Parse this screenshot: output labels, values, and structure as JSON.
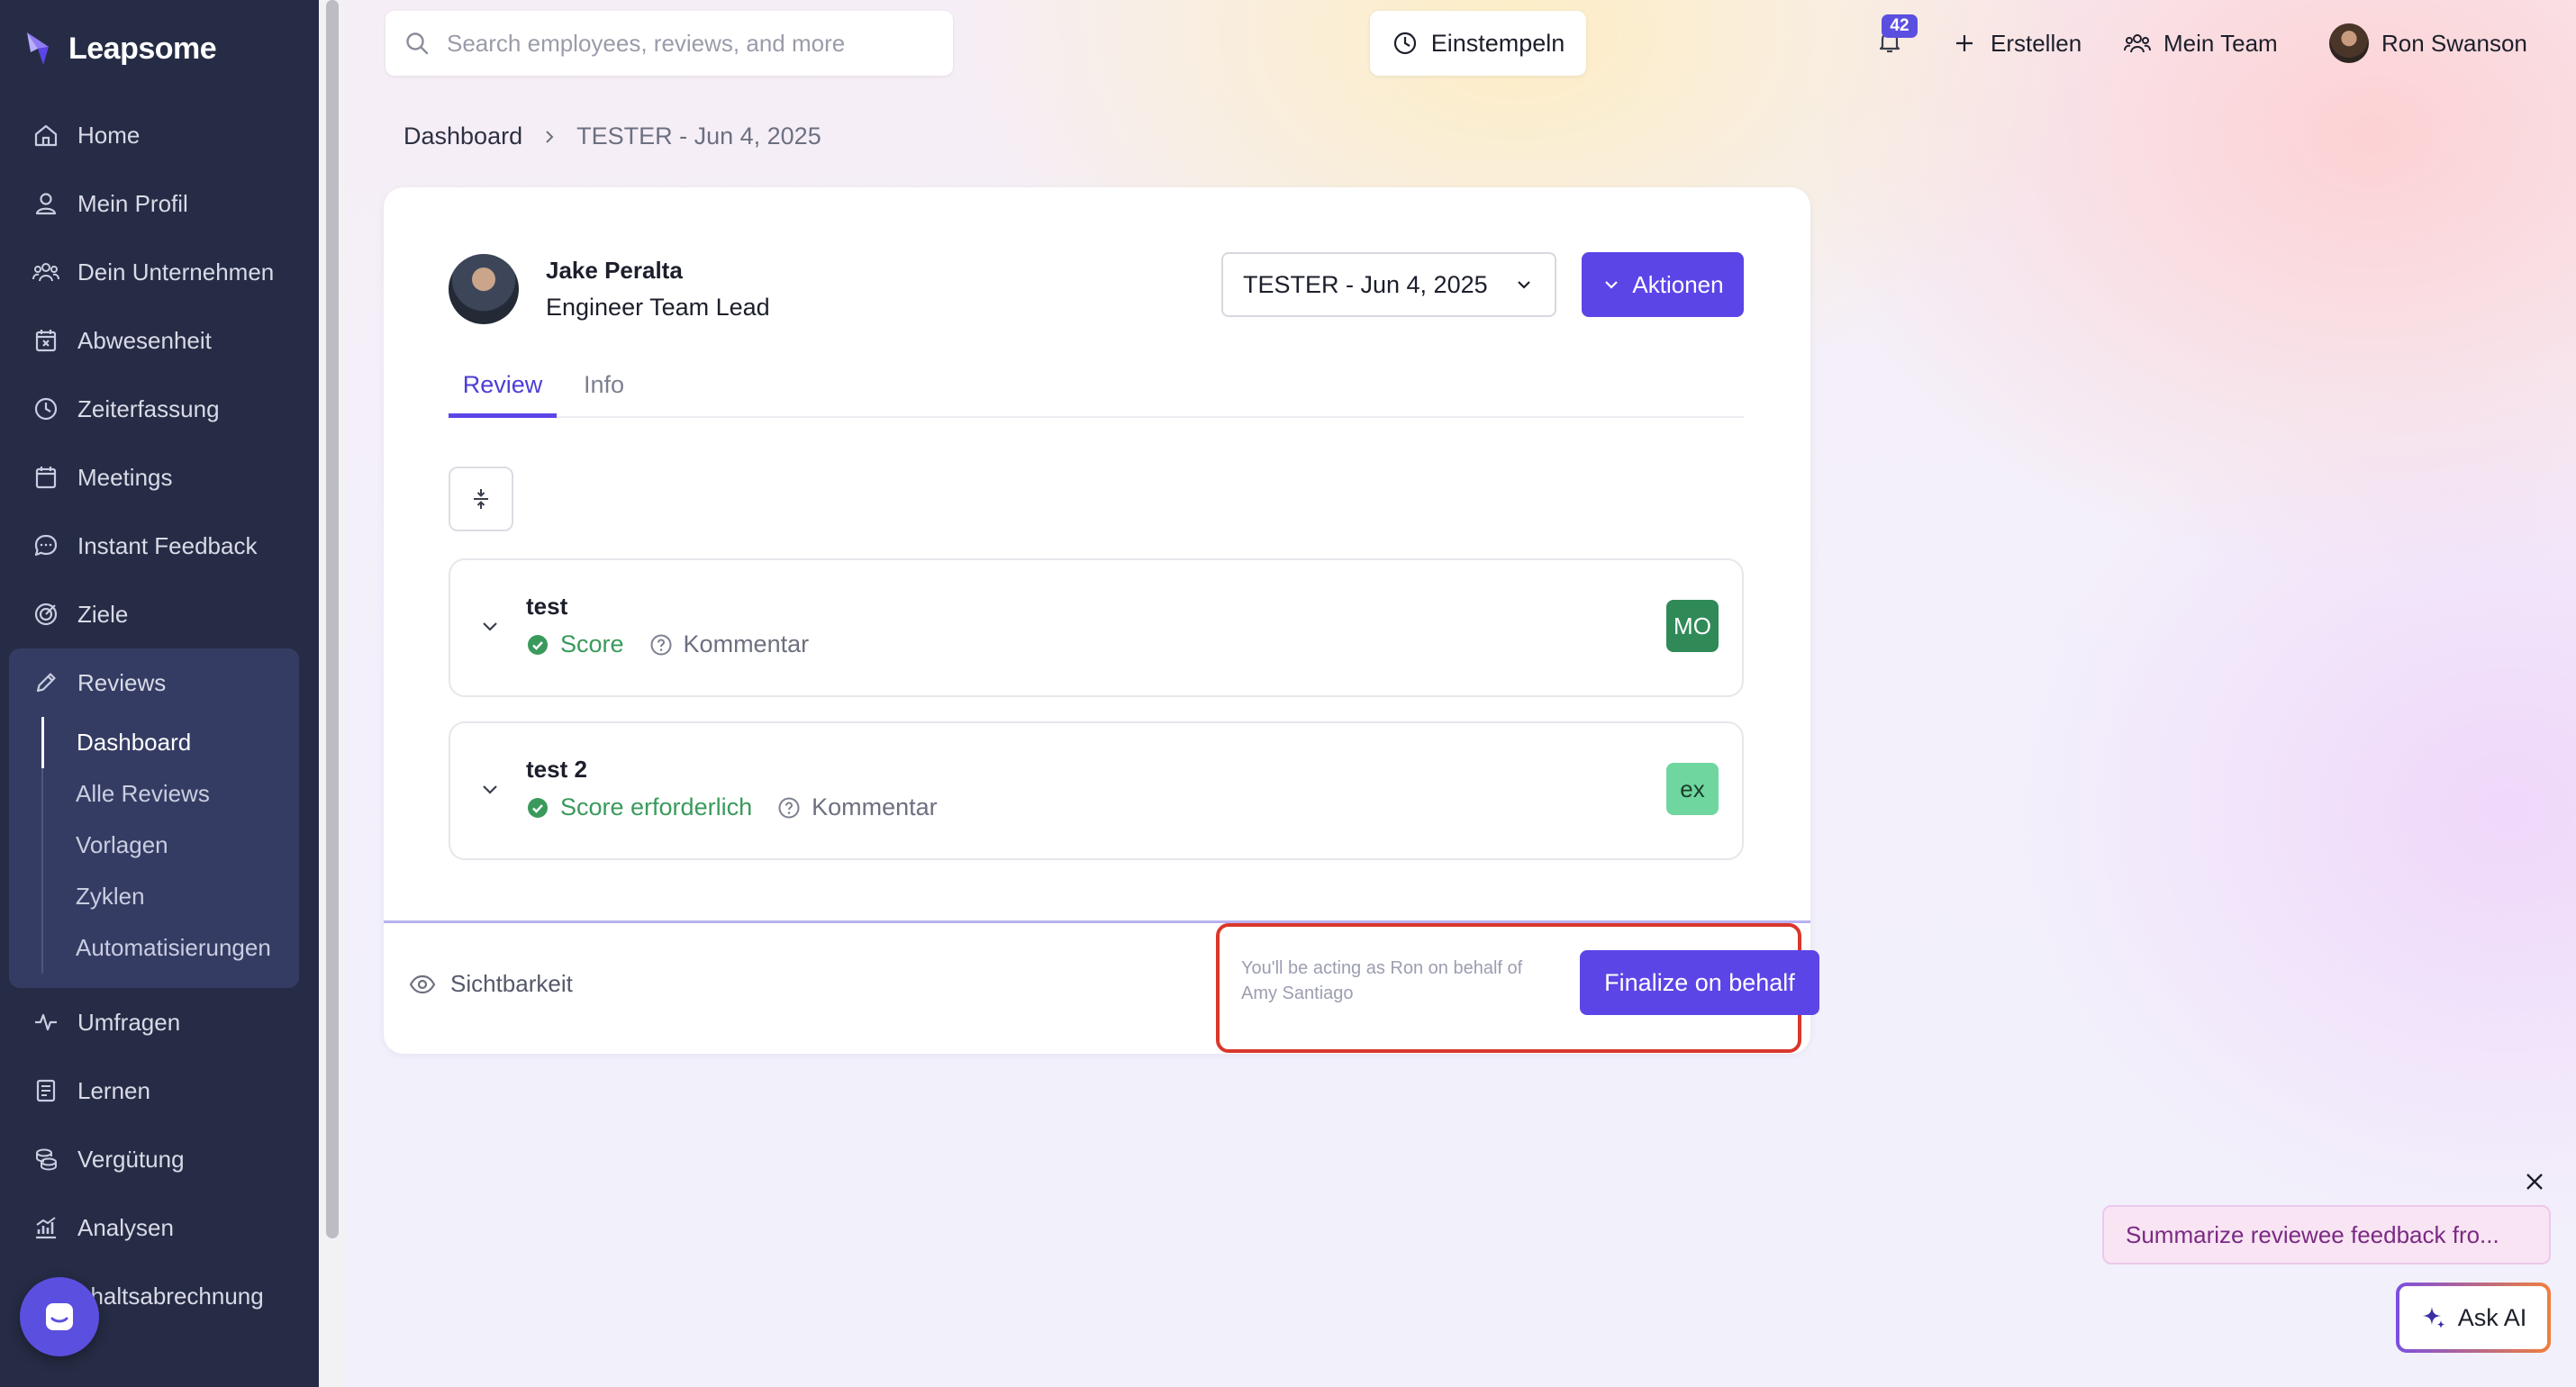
{
  "brand": {
    "name": "Leapsome"
  },
  "sidebar": {
    "items": [
      {
        "label": "Home",
        "icon": "home-icon"
      },
      {
        "label": "Mein Profil",
        "icon": "user-icon"
      },
      {
        "label": "Dein Unternehmen",
        "icon": "people-icon"
      },
      {
        "label": "Abwesenheit",
        "icon": "calendar-x-icon"
      },
      {
        "label": "Zeiterfassung",
        "icon": "clock-icon"
      },
      {
        "label": "Meetings",
        "icon": "calendar-icon"
      },
      {
        "label": "Instant Feedback",
        "icon": "chat-icon"
      },
      {
        "label": "Ziele",
        "icon": "target-icon"
      }
    ],
    "reviews": {
      "label": "Reviews",
      "icon": "pencil-icon",
      "subitems": [
        "Dashboard",
        "Alle Reviews",
        "Vorlagen",
        "Zyklen",
        "Automatisierungen"
      ],
      "active_subitem": "Dashboard"
    },
    "items_after": [
      {
        "label": "Umfragen",
        "icon": "pulse-icon"
      },
      {
        "label": "Lernen",
        "icon": "book-icon"
      },
      {
        "label": "Vergütung",
        "icon": "coins-icon"
      },
      {
        "label": "Analysen",
        "icon": "chart-icon"
      },
      {
        "label": "ehaltsabrechnung",
        "icon": "payroll-icon"
      }
    ]
  },
  "header": {
    "search_placeholder": "Search employees, reviews, and more",
    "clock_in_label": "Einstempeln",
    "notification_count": "42",
    "create_label": "Erstellen",
    "team_label": "Mein Team",
    "user_name": "Ron Swanson"
  },
  "breadcrumb": [
    "Dashboard",
    "TESTER - Jun 4, 2025"
  ],
  "review": {
    "person_name": "Jake Peralta",
    "person_role": "Engineer Team Lead",
    "period": "TESTER - Jun 4, 2025",
    "actions_label": "Aktionen",
    "tabs": [
      "Review",
      "Info"
    ],
    "active_tab": "Review",
    "questions": [
      {
        "title": "test",
        "score_label": "Score",
        "comment_label": "Kommentar",
        "badge": "MO",
        "badge_color": "#2f8a57"
      },
      {
        "title": "test 2",
        "score_label": "Score erforderlich",
        "comment_label": "Kommentar",
        "badge": "ex",
        "badge_color": "#6fd6a0"
      }
    ],
    "visibility_label": "Sichtbarkeit",
    "behalf_note": "You'll be acting as Ron on behalf of Amy Santiago",
    "finalize_label": "Finalize on behalf"
  },
  "ai": {
    "suggestion": "Summarize reviewee feedback fro...",
    "ask_label": "Ask AI"
  },
  "colors": {
    "sidebar_bg": "#262c45",
    "accent": "#5b45e6",
    "success": "#3a9a5c",
    "highlight": "#d9372b"
  }
}
